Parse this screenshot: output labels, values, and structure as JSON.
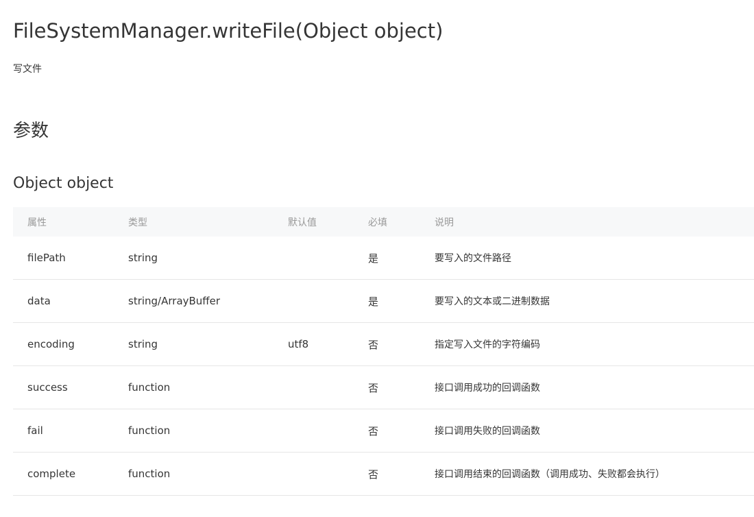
{
  "title": "FileSystemManager.writeFile(Object object)",
  "description": "写文件",
  "section_title": "参数",
  "sub_title": "Object object",
  "table": {
    "headers": {
      "name": "属性",
      "type": "类型",
      "default": "默认值",
      "required": "必填",
      "desc": "说明"
    },
    "rows": [
      {
        "name": "filePath",
        "type": "string",
        "default": "",
        "required": "是",
        "desc": "要写入的文件路径"
      },
      {
        "name": "data",
        "type": "string/ArrayBuffer",
        "default": "",
        "required": "是",
        "desc": "要写入的文本或二进制数据"
      },
      {
        "name": "encoding",
        "type": "string",
        "default": "utf8",
        "required": "否",
        "desc": "指定写入文件的字符编码"
      },
      {
        "name": "success",
        "type": "function",
        "default": "",
        "required": "否",
        "desc": "接口调用成功的回调函数"
      },
      {
        "name": "fail",
        "type": "function",
        "default": "",
        "required": "否",
        "desc": "接口调用失败的回调函数"
      },
      {
        "name": "complete",
        "type": "function",
        "default": "",
        "required": "否",
        "desc": "接口调用结束的回调函数（调用成功、失败都会执行）"
      }
    ]
  }
}
